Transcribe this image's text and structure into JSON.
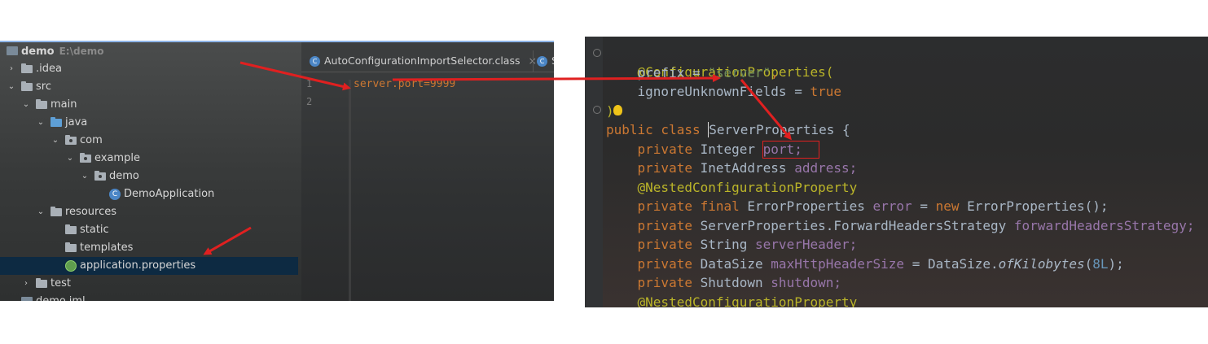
{
  "project_tree": {
    "items": [
      {
        "label": "demo",
        "sub": "E:\\demo"
      },
      {
        "label": ".idea"
      },
      {
        "label": "src"
      },
      {
        "label": "main"
      },
      {
        "label": "java"
      },
      {
        "label": "com"
      },
      {
        "label": "example"
      },
      {
        "label": "demo"
      },
      {
        "label": "DemoApplication"
      },
      {
        "label": "resources"
      },
      {
        "label": "static"
      },
      {
        "label": "templates"
      },
      {
        "label": "application.properties"
      },
      {
        "label": "test"
      },
      {
        "label": "demo.iml"
      }
    ]
  },
  "editor_left": {
    "tabs": [
      {
        "label": "AutoConfigurationImportSelector.class",
        "close": "×"
      },
      {
        "label": "S"
      }
    ],
    "line_numbers": [
      "1",
      "2"
    ],
    "code": "server.port=9999"
  },
  "editor_right": {
    "lines": [
      [
        "@ConfigurationProperties("
      ],
      [
        "    prefix = ",
        "\"server\"",
        ","
      ],
      [
        "    ignoreUnknownFields = ",
        "true"
      ],
      [
        ")"
      ],
      [
        "public class ",
        "ServerProperties {"
      ],
      [
        "    private ",
        "Integer ",
        "port;"
      ],
      [
        "    private ",
        "InetAddress ",
        "address;"
      ],
      [
        "    @NestedConfigurationProperty"
      ],
      [
        "    private final ",
        "ErrorProperties ",
        "error",
        " = ",
        "new ",
        "ErrorProperties();"
      ],
      [
        "    private ",
        "ServerProperties.ForwardHeadersStrategy ",
        "forwardHeadersStrategy;"
      ],
      [
        "    private ",
        "String ",
        "serverHeader;"
      ],
      [
        "    private ",
        "DataSize ",
        "maxHttpHeaderSize",
        " = DataSize.",
        "ofKilobytes",
        "(",
        "8L",
        ");"
      ],
      [
        "    private ",
        "Shutdown ",
        "shutdown;"
      ],
      [
        "    @NestedConfigurationProperty"
      ]
    ]
  },
  "colors": {
    "annotation_red": "#e02020",
    "keyword": "#cc7832",
    "annotation": "#bbb529",
    "string": "#6a8759",
    "field": "#9876aa",
    "number": "#6897bb"
  }
}
